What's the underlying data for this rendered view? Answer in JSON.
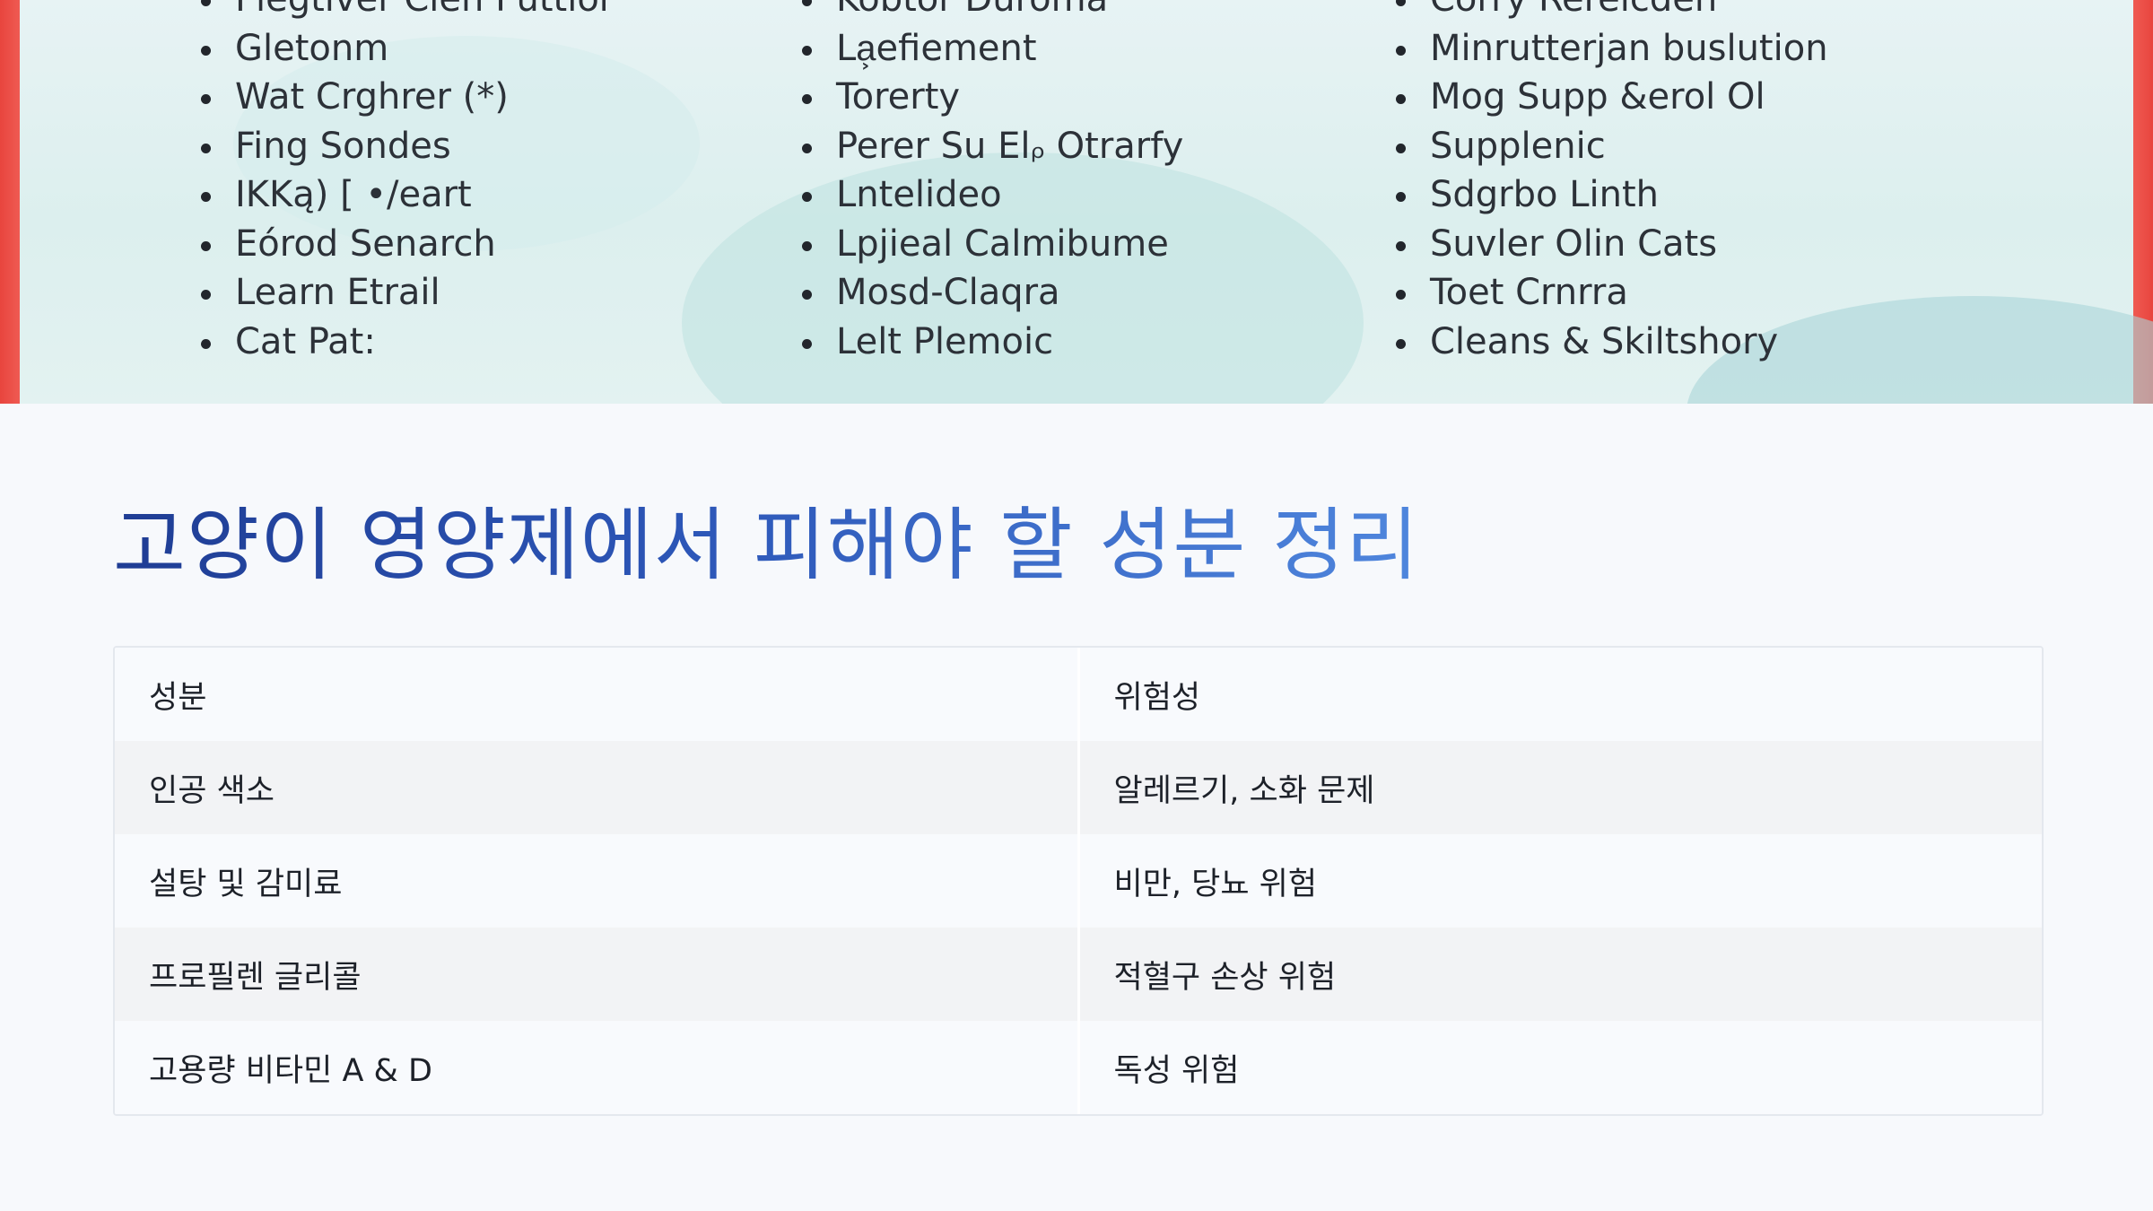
{
  "image_panel": {
    "columns": [
      {
        "items": [
          "Flegtiver Clen Puttlor",
          "Gletonm",
          "Wat Crghrer (*)",
          "Fing Sondes",
          "IKKą) [ •/eart",
          "Eórod Senarch",
          "Learn Etrail",
          "Cat Pat:"
        ]
      },
      {
        "items": [
          "Kobtor Duroma",
          "La͕efiement",
          "Torerty",
          "Perer Su Elᵨ Otrarfy",
          "Lntelideo",
          "Lpjieal Calmibume",
          "Mosd-Claqra",
          "Lelt Plemoic"
        ]
      },
      {
        "items": [
          "Corry Rerelcden",
          "Minrutterjan buslution",
          "Mog Supp &erol Ol",
          "Supplenic",
          "Sdgrbo Linth",
          "Suvler Olin Cats",
          "Toet Crnrra",
          "Cleans & Skiltshory"
        ]
      }
    ]
  },
  "title": "고양이 영양제에서 피해야 할 성분 정리",
  "table": {
    "headers": [
      "성분",
      "위험성"
    ],
    "rows": [
      [
        "인공 색소",
        "알레르기, 소화 문제"
      ],
      [
        "설탕 및 감미료",
        "비만, 당뇨 위험"
      ],
      [
        "프로필렌 글리콜",
        "적혈구 손상 위험"
      ],
      [
        "고용량 비타민 A & D",
        "독성 위험"
      ]
    ]
  },
  "colors": {
    "accent_edge": "#e8453e",
    "title_gradient_start": "#1f3d94",
    "title_gradient_end": "#4f86dd"
  }
}
